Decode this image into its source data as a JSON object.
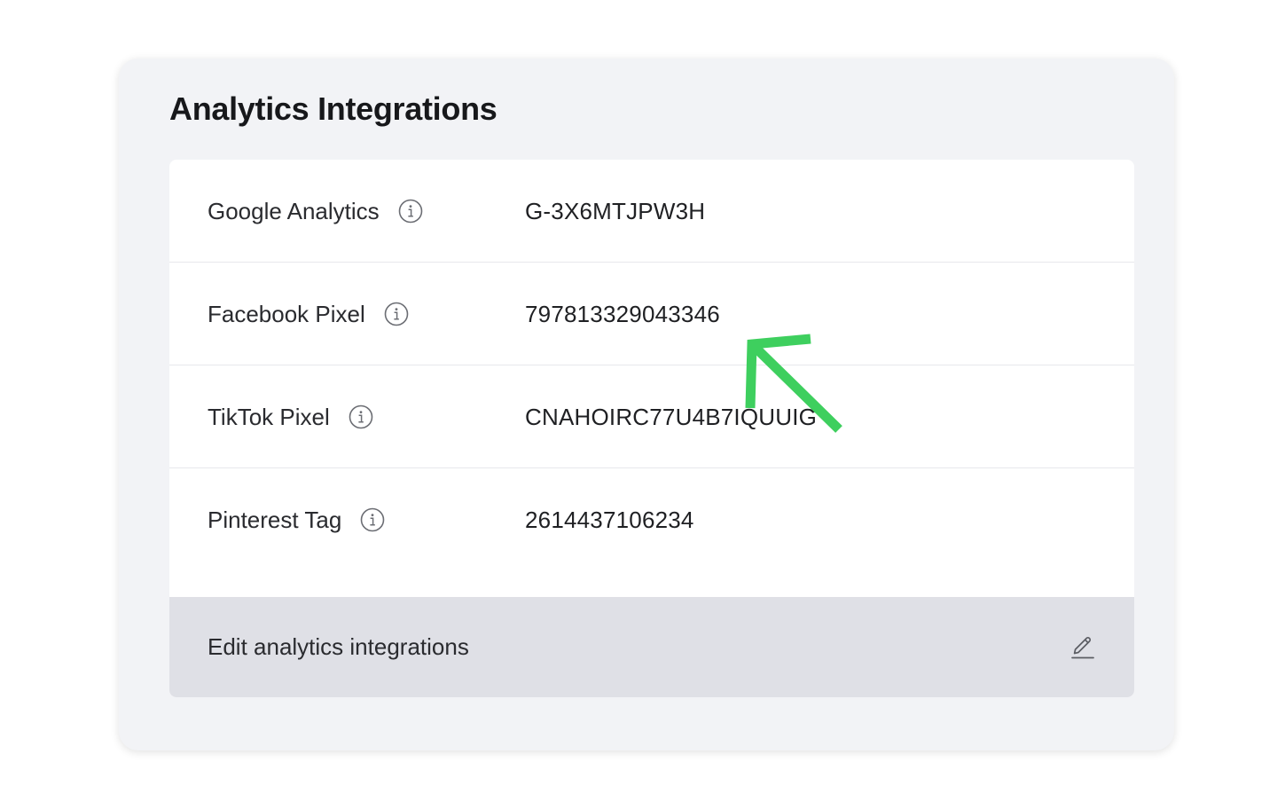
{
  "panel": {
    "title": "Analytics Integrations"
  },
  "integrations": [
    {
      "label": "Google Analytics",
      "value": "G-3X6MTJPW3H",
      "icon": "info-icon"
    },
    {
      "label": "Facebook Pixel",
      "value": "797813329043346",
      "icon": "info-icon"
    },
    {
      "label": "TikTok Pixel",
      "value": "CNAHOIRC77U4B7IQUUIG",
      "icon": "info-icon"
    },
    {
      "label": "Pinterest Tag",
      "value": "2614437106234",
      "icon": "info-icon"
    }
  ],
  "edit": {
    "label": "Edit analytics integrations",
    "icon": "pencil-icon"
  },
  "annotation": {
    "type": "arrow",
    "color": "#3ecf5e",
    "points_to": "Facebook Pixel value"
  },
  "colors": {
    "panel_bg": "#f2f3f6",
    "card_bg": "#ffffff",
    "edit_bg": "#dfe0e6",
    "text": "#1f2023",
    "arrow": "#3ecf5e"
  }
}
